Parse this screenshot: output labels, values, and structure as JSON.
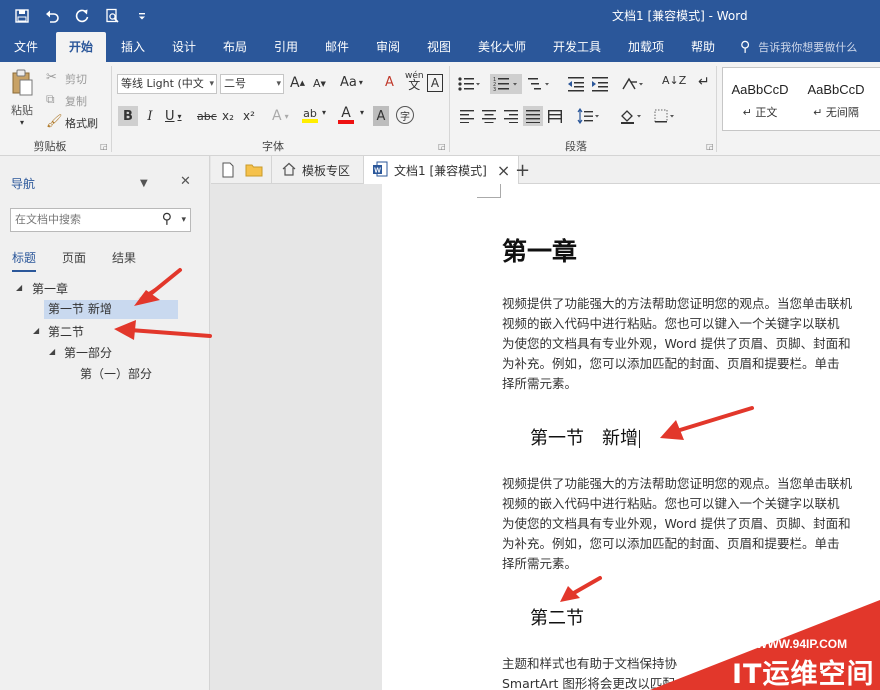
{
  "window": {
    "title": "文档1 [兼容模式] - Word"
  },
  "qat": {
    "icons": [
      "save-icon",
      "undo-icon",
      "redo-icon",
      "print-preview-icon",
      "customize-icon"
    ]
  },
  "ribbon_tabs": [
    "文件",
    "开始",
    "插入",
    "设计",
    "布局",
    "引用",
    "邮件",
    "审阅",
    "视图",
    "美化大师",
    "开发工具",
    "加载项",
    "帮助"
  ],
  "active_tab": "开始",
  "tell_me": {
    "placeholder": "告诉我你想要做什么"
  },
  "clipboard": {
    "paste": "粘贴",
    "cut": "剪切",
    "copy": "复制",
    "format_painter": "格式刷",
    "label": "剪贴板"
  },
  "font": {
    "name": "等线 Light (中文",
    "size": "二号",
    "grow": "A",
    "shrink": "A",
    "case": "Aa",
    "clear_format": "A",
    "phonetic": "wén",
    "border_char": "A",
    "bold": "B",
    "italic": "I",
    "underline": "U",
    "strike": "abc",
    "sub": "x₂",
    "sup": "x²",
    "text_effect": "A",
    "highlight": "ab",
    "font_color": "A",
    "shading": "A",
    "enclose": "字",
    "label": "字体"
  },
  "paragraph": {
    "label": "段落",
    "sort": "A↓Z",
    "marks": "↵"
  },
  "styles": {
    "items": [
      {
        "sample": "AaBbCcD",
        "name": "↵ 正文"
      },
      {
        "sample": "AaBbCcD",
        "name": "↵ 无间隔"
      }
    ]
  },
  "nav": {
    "title": "导航",
    "search_placeholder": "在文档中搜索",
    "tabs": [
      "标题",
      "页面",
      "结果"
    ],
    "tree": [
      "第一章",
      "第一节 新增",
      "第二节",
      "第一部分",
      "第（一）部分"
    ]
  },
  "doc_tabs": {
    "template": "模板专区",
    "doc": "文档1 [兼容模式]",
    "close": "×",
    "add": "+"
  },
  "document": {
    "heading1": "第一章",
    "para1": [
      "视频提供了功能强大的方法帮助您证明您的观点。当您单击联机",
      "视频的嵌入代码中进行粘贴。您也可以键入一个关键字以联机",
      "为使您的文档具有专业外观，Word 提供了页眉、页脚、封面和",
      "为补充。例如，您可以添加匹配的封面、页眉和提要栏。单击",
      "择所需元素。"
    ],
    "heading2a": "第一节　新增",
    "para2": [
      "视频提供了功能强大的方法帮助您证明您的观点。当您单击联机",
      "视频的嵌入代码中进行粘贴。您也可以键入一个关键字以联机",
      "为使您的文档具有专业外观，Word 提供了页眉、页脚、封面和",
      "为补充。例如，您可以添加匹配的封面、页眉和提要栏。单击",
      "择所需元素。"
    ],
    "heading2b": "第二节",
    "para3": [
      "主题和样式也有助于文档保持协",
      "SmartArt 图形将会更改以匹配"
    ]
  },
  "watermark": {
    "url": "WWW.94IP.COM",
    "name": "IT运维空间"
  },
  "colors": {
    "accent": "#2b579a",
    "arrow": "#e2372b",
    "nav_selected": "#c9d9ef"
  }
}
